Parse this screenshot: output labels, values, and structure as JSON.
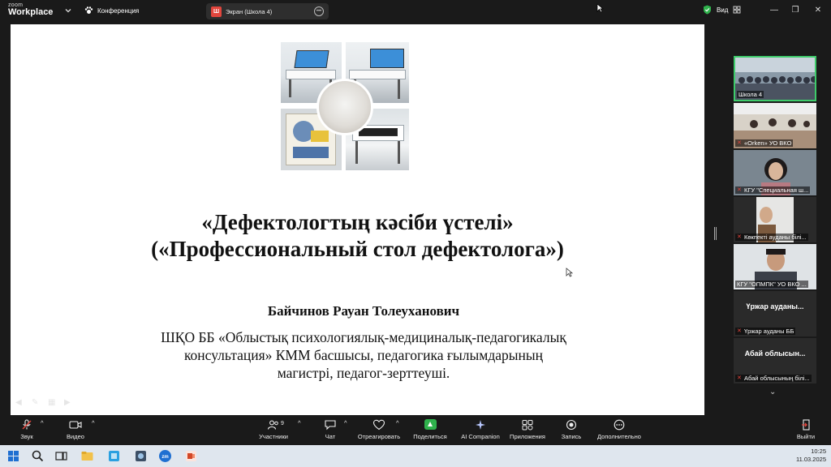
{
  "window": {
    "brand_top": "zoom",
    "brand_bottom": "Workplace",
    "meeting_label": "Конференция",
    "screen_share_badge": "Ш",
    "screen_share_title": "Экран (Школа 4)",
    "view_label": "Вид"
  },
  "slide": {
    "title_line1": "«Дефектологтың кәсіби үстелі»",
    "title_line2": "(«Профессиональный стол дефектолога»)",
    "author": "Байчинов Рауан Толеуханович",
    "desc_line1": "ШҚО ББ «Облыстық психологиялық-медициналық-педагогикалық",
    "desc_line2": "консультация» КММ басшысы, педагогика ғылымдарының",
    "desc_line3": "магистрі, педагог-зерттеуші."
  },
  "participants": [
    {
      "name": "Школа 4",
      "muted": false,
      "active": true
    },
    {
      "name": "«Orken» УО ВКО",
      "muted": true
    },
    {
      "name": "КГУ \"Специальная ш...",
      "muted": true
    },
    {
      "name": "Көкпекті ауданы білі...",
      "muted": true
    },
    {
      "name": "КГУ \"ОПМПК\" УО ВКО ...",
      "muted": false
    },
    {
      "name": "Үржар ауданы ББ",
      "muted": true,
      "big_name": "Үржар ауданы..."
    },
    {
      "name": "Абай облысының білі...",
      "muted": true,
      "big_name": "Абай облысын..."
    }
  ],
  "toolbar": {
    "audio": "Звук",
    "video": "Видео",
    "participants": "Участники",
    "participants_count": "9",
    "chat": "Чат",
    "react": "Отреагировать",
    "share": "Поделиться",
    "ai": "AI Companion",
    "apps": "Приложения",
    "record": "Запись",
    "more": "Дополнительно",
    "leave": "Выйти"
  },
  "taskbar": {
    "time": "10:25",
    "date": "11.03.2025"
  },
  "colors": {
    "active_border": "#3ecb6a",
    "share_green": "#2fb24c",
    "muted_red": "#e0443c",
    "leave_red": "#e2463d"
  }
}
